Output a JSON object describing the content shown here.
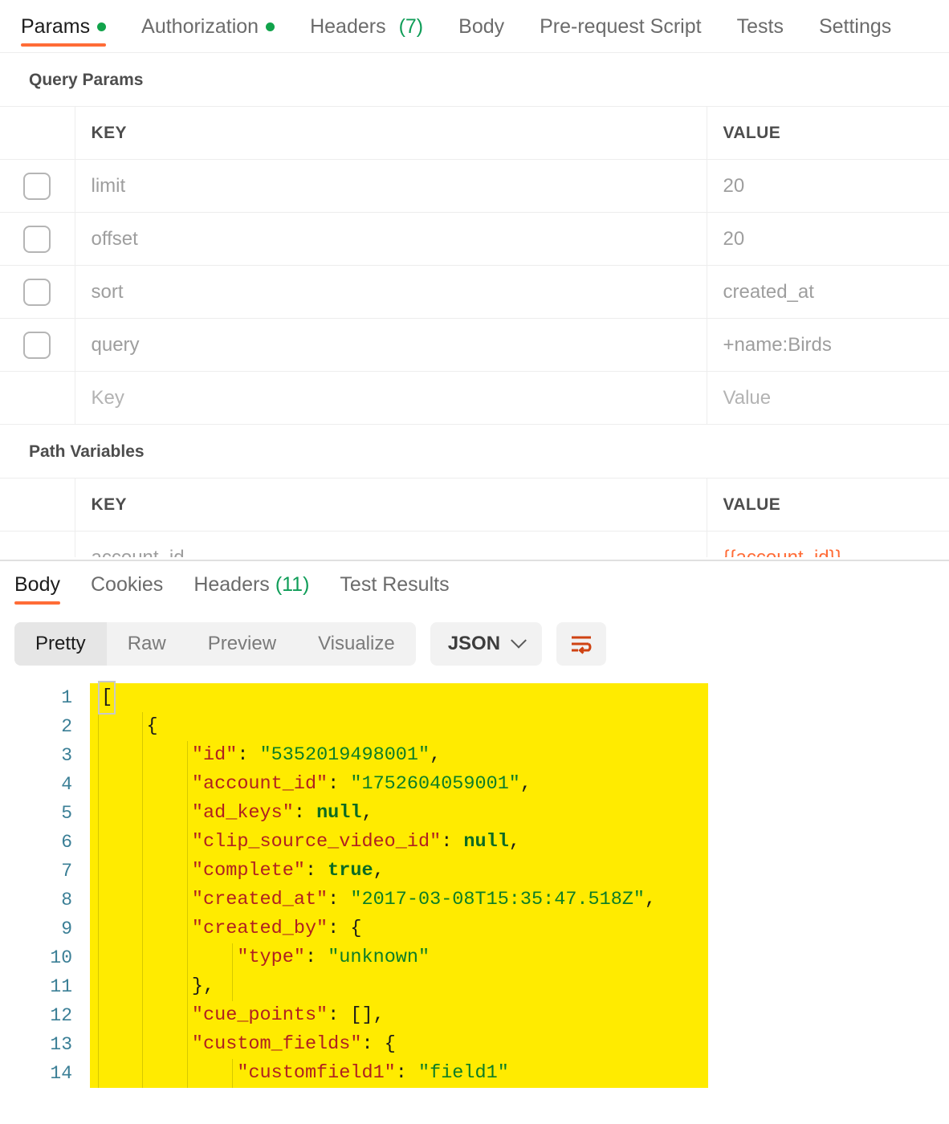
{
  "request": {
    "tabs": [
      {
        "label": "Params",
        "indicator": "dot",
        "active": true
      },
      {
        "label": "Authorization",
        "indicator": "dot",
        "active": false
      },
      {
        "label": "Headers",
        "count": "(7)",
        "active": false
      },
      {
        "label": "Body",
        "active": false
      },
      {
        "label": "Pre-request Script",
        "active": false
      },
      {
        "label": "Tests",
        "active": false
      },
      {
        "label": "Settings",
        "active": false
      }
    ],
    "query_params": {
      "section_title": "Query Params",
      "columns": {
        "key": "KEY",
        "value": "VALUE"
      },
      "rows": [
        {
          "checked": false,
          "key": "limit",
          "value": "20",
          "placeholder": false
        },
        {
          "checked": false,
          "key": "offset",
          "value": "20",
          "placeholder": false
        },
        {
          "checked": false,
          "key": "sort",
          "value": "created_at",
          "placeholder": false
        },
        {
          "checked": false,
          "key": "query",
          "value": "+name:Birds",
          "placeholder": false
        },
        {
          "checked": false,
          "key": "Key",
          "value": "Value",
          "placeholder": true
        }
      ]
    },
    "path_variables": {
      "section_title": "Path Variables",
      "columns": {
        "key": "KEY",
        "value": "VALUE"
      },
      "rows": [
        {
          "key": "account_id",
          "value": "{{account_id}}",
          "is_variable": true
        }
      ]
    }
  },
  "response": {
    "tabs": [
      {
        "label": "Body",
        "active": true
      },
      {
        "label": "Cookies",
        "active": false
      },
      {
        "label": "Headers",
        "count": "(11)",
        "active": false
      },
      {
        "label": "Test Results",
        "active": false
      }
    ],
    "viewer": {
      "modes": [
        {
          "label": "Pretty",
          "active": true
        },
        {
          "label": "Raw",
          "active": false
        },
        {
          "label": "Preview",
          "active": false
        },
        {
          "label": "Visualize",
          "active": false
        }
      ],
      "format": "JSON",
      "wrap_icon": "wrap-lines-icon"
    },
    "code": {
      "line_numbers": [
        "1",
        "2",
        "3",
        "4",
        "5",
        "6",
        "7",
        "8",
        "9",
        "10",
        "11",
        "12",
        "13",
        "14"
      ],
      "lines": [
        {
          "n": "1",
          "indent": 0,
          "tokens": [
            {
              "t": "[",
              "c": "p",
              "bracket_match": true
            }
          ]
        },
        {
          "n": "2",
          "indent": 1,
          "tokens": [
            {
              "t": "{",
              "c": "p"
            }
          ]
        },
        {
          "n": "3",
          "indent": 2,
          "tokens": [
            {
              "t": "\"id\"",
              "c": "k"
            },
            {
              "t": ": ",
              "c": "p"
            },
            {
              "t": "\"5352019498001\"",
              "c": "s"
            },
            {
              "t": ",",
              "c": "p"
            }
          ]
        },
        {
          "n": "4",
          "indent": 2,
          "tokens": [
            {
              "t": "\"account_id\"",
              "c": "k"
            },
            {
              "t": ": ",
              "c": "p"
            },
            {
              "t": "\"1752604059001\"",
              "c": "s"
            },
            {
              "t": ",",
              "c": "p"
            }
          ]
        },
        {
          "n": "5",
          "indent": 2,
          "tokens": [
            {
              "t": "\"ad_keys\"",
              "c": "k"
            },
            {
              "t": ": ",
              "c": "p"
            },
            {
              "t": "null",
              "c": "lit"
            },
            {
              "t": ",",
              "c": "p"
            }
          ]
        },
        {
          "n": "6",
          "indent": 2,
          "tokens": [
            {
              "t": "\"clip_source_video_id\"",
              "c": "k"
            },
            {
              "t": ": ",
              "c": "p"
            },
            {
              "t": "null",
              "c": "lit"
            },
            {
              "t": ",",
              "c": "p"
            }
          ]
        },
        {
          "n": "7",
          "indent": 2,
          "tokens": [
            {
              "t": "\"complete\"",
              "c": "k"
            },
            {
              "t": ": ",
              "c": "p"
            },
            {
              "t": "true",
              "c": "lit"
            },
            {
              "t": ",",
              "c": "p"
            }
          ]
        },
        {
          "n": "8",
          "indent": 2,
          "tokens": [
            {
              "t": "\"created_at\"",
              "c": "k"
            },
            {
              "t": ": ",
              "c": "p"
            },
            {
              "t": "\"2017-03-08T15:35:47.518Z\"",
              "c": "s"
            },
            {
              "t": ",",
              "c": "p"
            }
          ]
        },
        {
          "n": "9",
          "indent": 2,
          "tokens": [
            {
              "t": "\"created_by\"",
              "c": "k"
            },
            {
              "t": ": ",
              "c": "p"
            },
            {
              "t": "{",
              "c": "p"
            }
          ]
        },
        {
          "n": "10",
          "indent": 3,
          "tokens": [
            {
              "t": "\"type\"",
              "c": "k"
            },
            {
              "t": ": ",
              "c": "p"
            },
            {
              "t": "\"unknown\"",
              "c": "s"
            }
          ]
        },
        {
          "n": "11",
          "indent": 2,
          "tokens": [
            {
              "t": "},",
              "c": "p"
            }
          ]
        },
        {
          "n": "12",
          "indent": 2,
          "tokens": [
            {
              "t": "\"cue_points\"",
              "c": "k"
            },
            {
              "t": ": ",
              "c": "p"
            },
            {
              "t": "[],",
              "c": "p"
            }
          ]
        },
        {
          "n": "13",
          "indent": 2,
          "tokens": [
            {
              "t": "\"custom_fields\"",
              "c": "k"
            },
            {
              "t": ": ",
              "c": "p"
            },
            {
              "t": "{",
              "c": "p"
            }
          ]
        },
        {
          "n": "14",
          "indent": 3,
          "tokens": [
            {
              "t": "\"customfield1\"",
              "c": "k"
            },
            {
              "t": ": ",
              "c": "p"
            },
            {
              "t": "\"field1\"",
              "c": "s"
            }
          ]
        }
      ]
    }
  },
  "colors": {
    "accent": "#ff6c37",
    "status_dot": "#11A34B",
    "count_text": "#0f9D58",
    "highlight": "#ffeb00",
    "json_key": "#b02020",
    "json_string": "#0b7d26",
    "json_literal": "#0b6b23",
    "line_number": "#3b7f96"
  }
}
